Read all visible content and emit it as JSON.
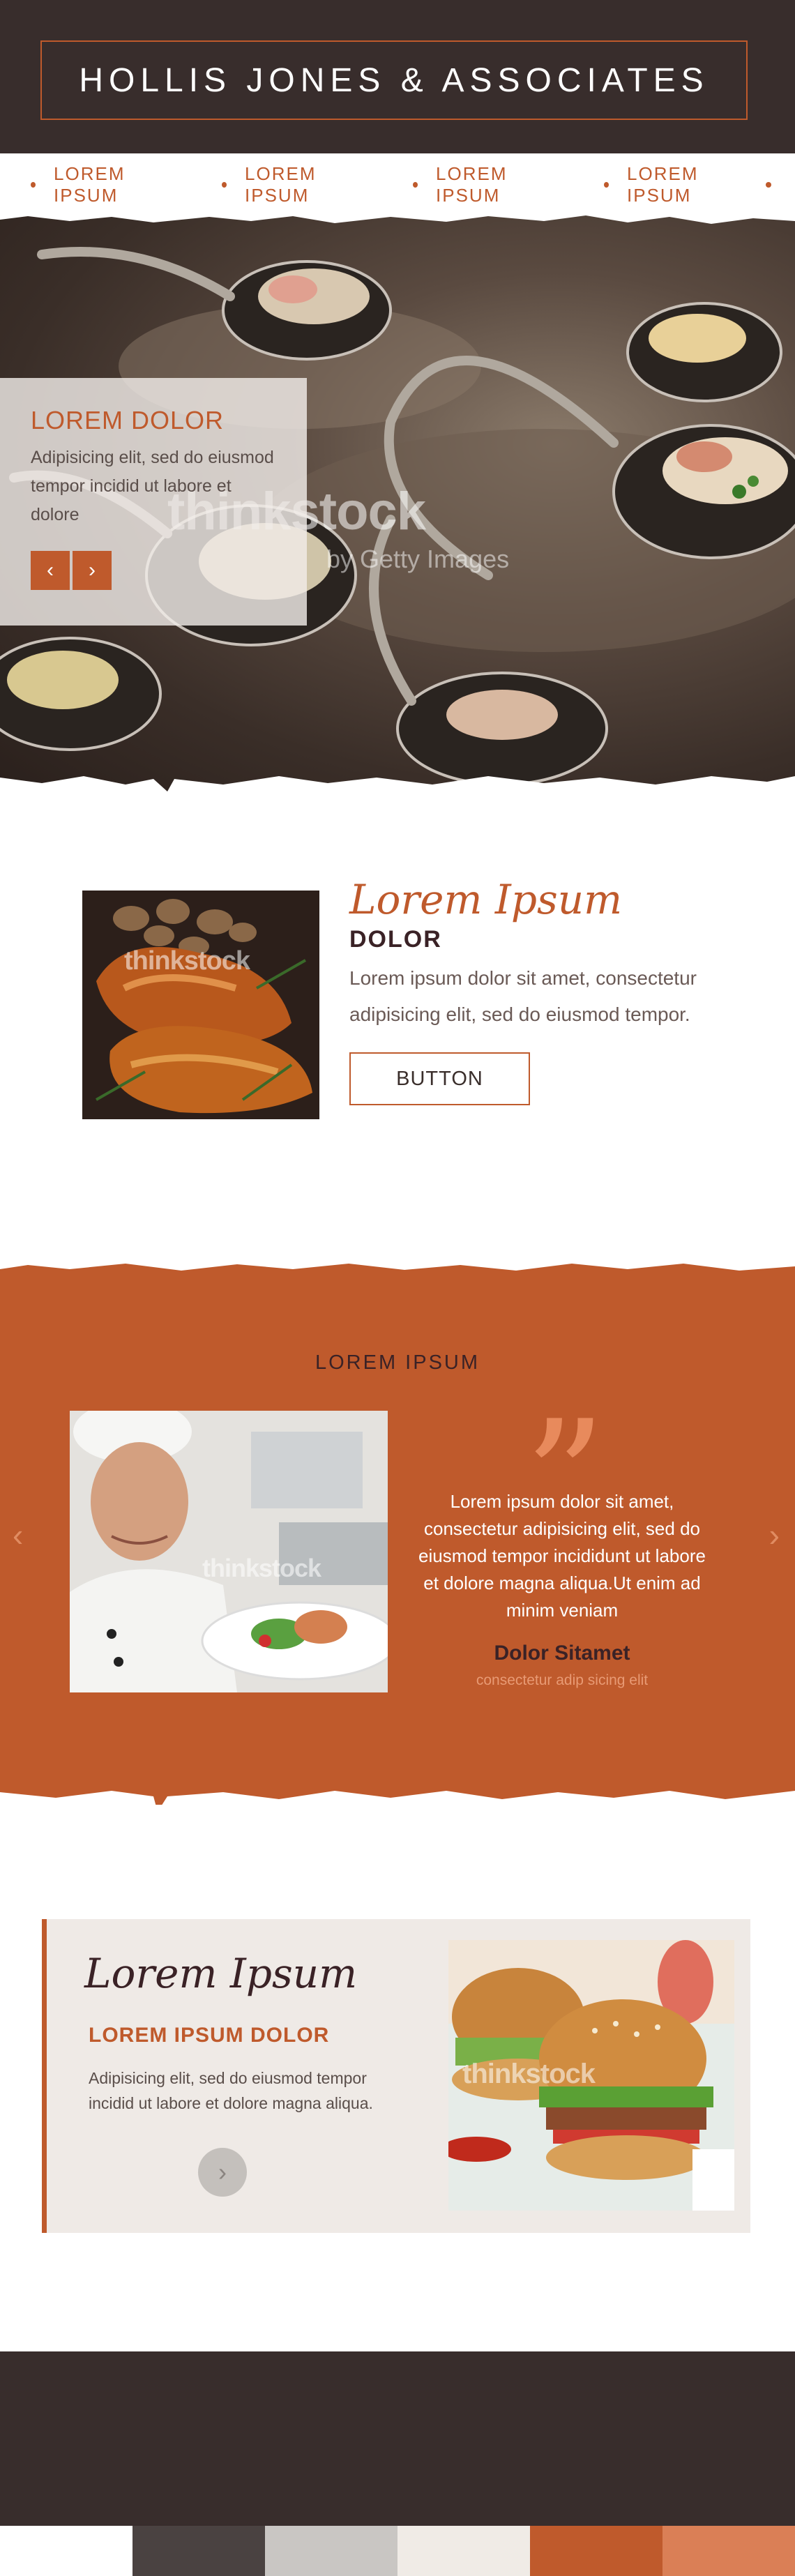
{
  "header": {
    "logo": "HOLLIS JONES & ASSOCIATES"
  },
  "nav": {
    "items": [
      {
        "label": "LOREM IPSUM"
      },
      {
        "label": "LOREM IPSUM"
      },
      {
        "label": "LOREM IPSUM"
      },
      {
        "label": "LOREM IPSUM"
      }
    ]
  },
  "hero": {
    "title": "LOREM DOLOR",
    "text": "Adipisicing elit, sed do eiusmod tempor incidid ut labore et dolore",
    "prev_icon": "‹",
    "next_icon": "›",
    "watermark": "thinkstock",
    "watermark_sub": "by Getty Images"
  },
  "feature": {
    "script_title": "Lorem Ipsum",
    "subtitle": "DOLOR",
    "text": "Lorem ipsum dolor sit amet, consectetur adipisicing elit, sed do eiusmod tempor.",
    "button_label": "BUTTON",
    "watermark": "thinkstock"
  },
  "testimonial": {
    "title": "LOREM IPSUM",
    "quote_mark": "”",
    "quote": "Lorem ipsum dolor sit amet, consectetur adipisicing elit, sed do eiusmod tempor incididunt ut labore et dolore magna aliqua.Ut enim ad minim veniam",
    "author": "Dolor Sitamet",
    "role": "consectetur adip sicing elit",
    "prev_icon": "‹",
    "next_icon": "›",
    "watermark": "thinkstock"
  },
  "card": {
    "script_title": "Lorem Ipsum",
    "subtitle": "LOREM IPSUM DOLOR",
    "text": "Adipisicing elit, sed do eiusmod tempor incidid ut labore et dolore magna aliqua.",
    "button_icon": "›",
    "watermark": "thinkstock"
  },
  "palette": {
    "colors": [
      "#ffffff",
      "#4a4241",
      "#c9c6c3",
      "#f0ebe6",
      "#bf5a2c",
      "#da7f56"
    ]
  },
  "colors": {
    "accent": "#bf5a2c",
    "dark": "#382d2c",
    "light": "#efeae6"
  }
}
